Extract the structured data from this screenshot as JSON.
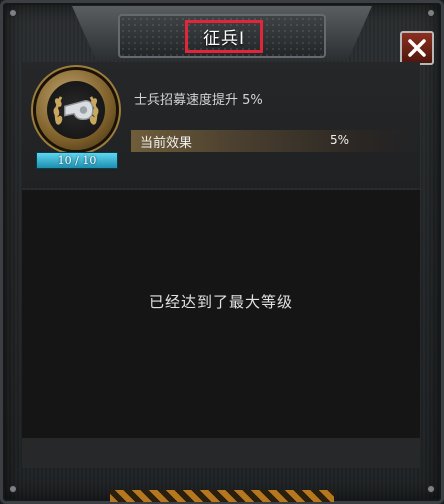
{
  "dialog": {
    "title": "征兵I",
    "description": "士兵招募速度提升 5%",
    "current_effect_label": "当前效果",
    "current_effect_value": "5%",
    "level": "10 / 10",
    "max_level_message": "已经达到了最大等级"
  },
  "icons": {
    "close": "close-x-icon",
    "skill": "whistle-laurel-icon"
  },
  "colors": {
    "title_highlight_border": "#e0263a",
    "level_bar": "#3fbfe0",
    "close_button": "#8b2f20",
    "effect_row": "#6f5d3a"
  }
}
